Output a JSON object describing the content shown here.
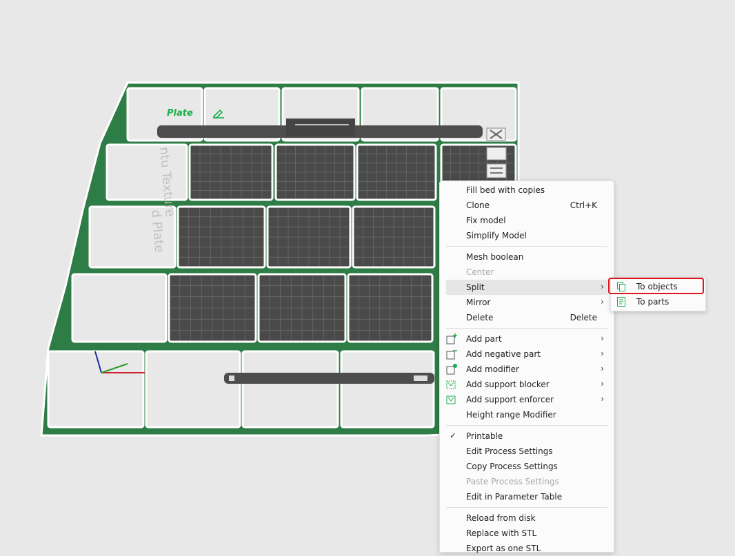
{
  "plate": {
    "label": "Plate",
    "texture_text_1": "ntu Texture",
    "texture_text_2": "d Plate"
  },
  "context_menu": {
    "items": [
      {
        "label": "Fill bed with copies"
      },
      {
        "label": "Clone",
        "shortcut": "Ctrl+K"
      },
      {
        "label": "Fix model"
      },
      {
        "label": "Simplify Model"
      },
      {
        "label": "Mesh boolean"
      },
      {
        "label": "Center",
        "disabled": true
      },
      {
        "label": "Split",
        "submenu": true,
        "hovered": true
      },
      {
        "label": "Mirror",
        "submenu": true
      },
      {
        "label": "Delete",
        "shortcut": "Delete"
      },
      {
        "label": "Add part",
        "submenu": true,
        "icon": "add-part-icon"
      },
      {
        "label": "Add negative part",
        "submenu": true,
        "icon": "add-negative-part-icon"
      },
      {
        "label": "Add modifier",
        "submenu": true,
        "icon": "add-modifier-icon"
      },
      {
        "label": "Add support blocker",
        "submenu": true,
        "icon": "support-blocker-icon"
      },
      {
        "label": "Add support enforcer",
        "submenu": true,
        "icon": "support-enforcer-icon"
      },
      {
        "label": "Height range Modifier"
      },
      {
        "label": "Printable",
        "checked": true
      },
      {
        "label": "Edit Process Settings"
      },
      {
        "label": "Copy Process Settings"
      },
      {
        "label": "Paste Process Settings",
        "disabled": true
      },
      {
        "label": "Edit in Parameter Table"
      },
      {
        "label": "Reload from disk"
      },
      {
        "label": "Replace with STL"
      },
      {
        "label": "Export as one STL"
      }
    ]
  },
  "split_submenu": {
    "items": [
      {
        "label": "To objects",
        "icon": "split-to-objects-icon",
        "highlighted": true
      },
      {
        "label": "To parts",
        "icon": "split-to-parts-icon"
      }
    ]
  },
  "colors": {
    "frame_green": "#2f8a4a",
    "accent_green": "#19b04a",
    "highlight_red": "#e0121a",
    "grid_dark": "#4a4a4a"
  }
}
